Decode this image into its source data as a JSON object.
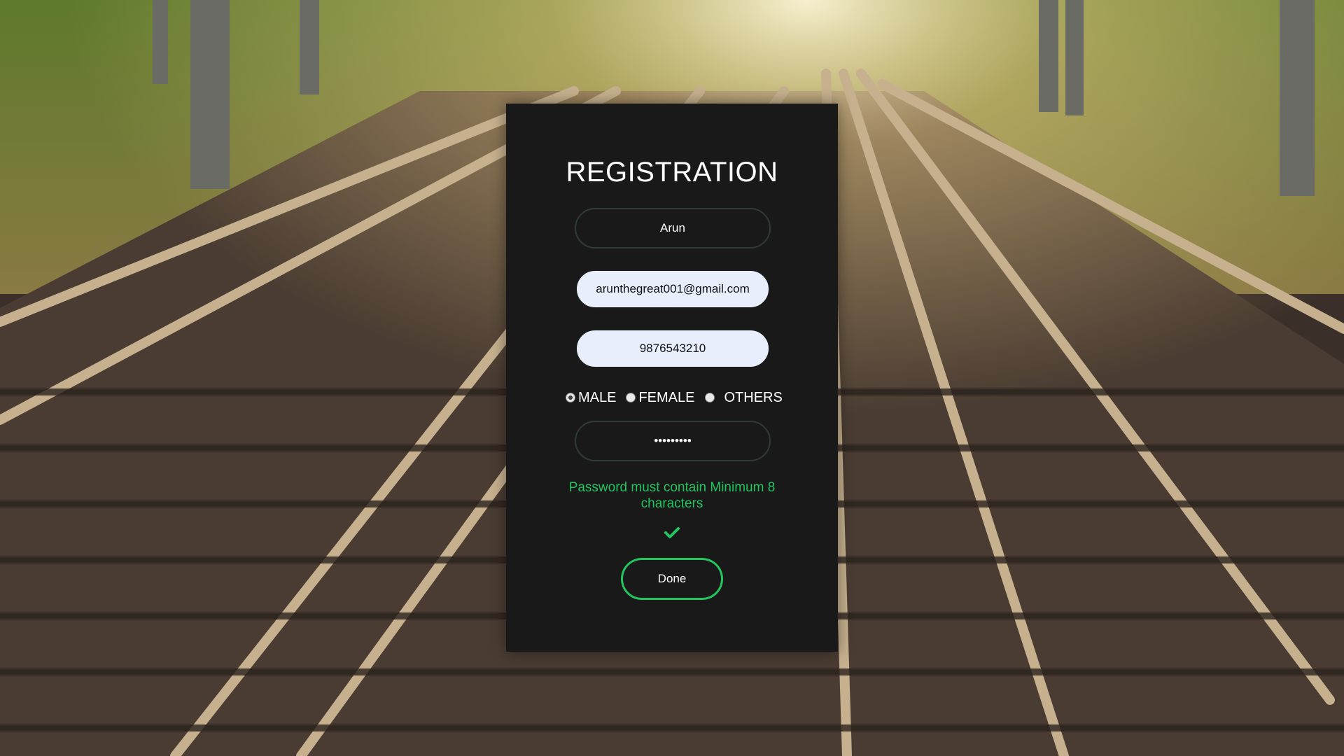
{
  "form": {
    "title": "REGISTRATION",
    "name_value": "Arun",
    "email_value": "arunthegreat001@gmail.com",
    "phone_value": "9876543210",
    "password_value": "•••••••••",
    "gender_options": [
      {
        "label": "MALE",
        "selected": true
      },
      {
        "label": "FEMALE",
        "selected": false
      },
      {
        "label": "OTHERS",
        "selected": false
      }
    ],
    "password_hint": "Password must contain Minimum 8 characters",
    "done_label": "Done",
    "check_icon": "check-icon"
  },
  "colors": {
    "card_background": "#191919",
    "accent_green": "#22c55e",
    "hint_green": "#21c45d",
    "autofill_background": "#e8eefb"
  },
  "background": {
    "description_icon": "railway-tracks-photo"
  }
}
